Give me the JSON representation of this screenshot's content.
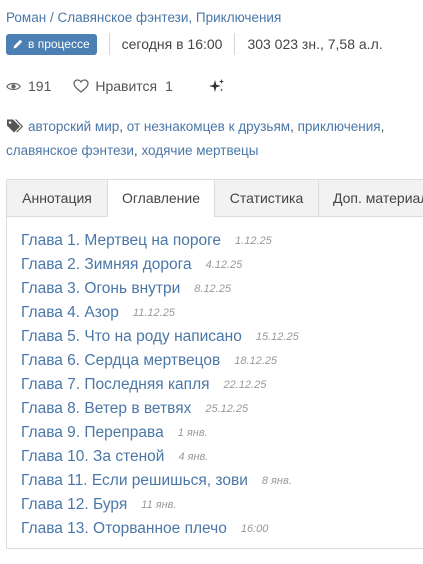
{
  "header": {
    "form": "Роман",
    "separator": "/",
    "genres": "Славянское фэнтези, Приключения"
  },
  "status": {
    "badge": "в процессе",
    "updated": "сегодня в 16:00",
    "size": "303 023 зн., 7,58 а.л."
  },
  "stats": {
    "views": "191",
    "like_label": "Нравится",
    "like_count": "1"
  },
  "tags": [
    "авторский мир",
    "от незнакомцев к друзьям",
    "приключения",
    "славянское фэнтези",
    "ходячие мертвецы"
  ],
  "tabs": [
    "Аннотация",
    "Оглавление",
    "Статистика",
    "Доп. материалы"
  ],
  "active_tab": "Оглавление",
  "chapters": [
    {
      "title": "Глава 1. Мертвец на пороге",
      "date": "1.12.25"
    },
    {
      "title": "Глава 2. Зимняя дорога",
      "date": "4.12.25"
    },
    {
      "title": "Глава 3. Огонь внутри",
      "date": "8.12.25"
    },
    {
      "title": "Глава 4. Азор",
      "date": "11.12.25"
    },
    {
      "title": "Глава 5. Что на роду написано",
      "date": "15.12.25"
    },
    {
      "title": "Глава 6. Сердца мертвецов",
      "date": "18.12.25"
    },
    {
      "title": "Глава 7. Последняя капля",
      "date": "22.12.25"
    },
    {
      "title": "Глава 8. Ветер в ветвях",
      "date": "25.12.25"
    },
    {
      "title": "Глава 9. Переправа",
      "date": "1 янв."
    },
    {
      "title": "Глава 10. За стеной",
      "date": "4 янв."
    },
    {
      "title": "Глава 11. Если решишься, зови",
      "date": "8 янв."
    },
    {
      "title": "Глава 12. Буря",
      "date": "11 янв."
    },
    {
      "title": "Глава 13. Оторванное плечо",
      "date": "16:00"
    }
  ],
  "colors": {
    "link": "#4a77a8",
    "badge_bg": "#4c7fb3",
    "muted": "#999999"
  },
  "icons": [
    "pencil-icon",
    "eye-icon",
    "heart-icon",
    "sparkle-icon",
    "tags-icon"
  ]
}
